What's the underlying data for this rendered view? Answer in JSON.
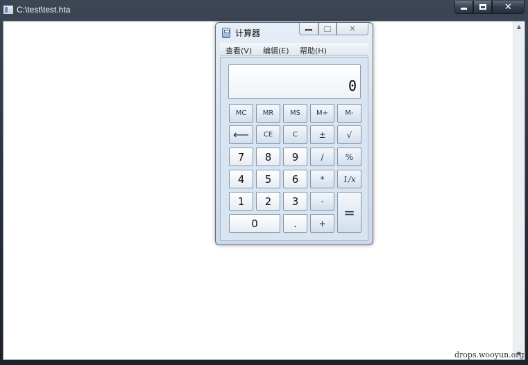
{
  "outer_window": {
    "title": "C:\\test\\test.hta",
    "controls": {
      "minimize": "minimize",
      "maximize": "maximize",
      "close": "✕"
    }
  },
  "calculator": {
    "title": "计算器",
    "menu": [
      "查看(V)",
      "编辑(E)",
      "帮助(H)"
    ],
    "display": "0",
    "keys": {
      "mc": "MC",
      "mr": "MR",
      "ms": "MS",
      "mplus": "M+",
      "mminus": "M-",
      "backspace": "⟵",
      "ce": "CE",
      "c": "C",
      "plusminus": "±",
      "sqrt": "√",
      "seven": "7",
      "eight": "8",
      "nine": "9",
      "divide": "/",
      "percent": "%",
      "four": "4",
      "five": "5",
      "six": "6",
      "multiply": "*",
      "reciprocal": "1/x",
      "one": "1",
      "two": "2",
      "three": "3",
      "minus": "-",
      "equals": "=",
      "zero": "0",
      "dot": ".",
      "plus": "+"
    }
  },
  "watermark": "drops.wooyun.org"
}
